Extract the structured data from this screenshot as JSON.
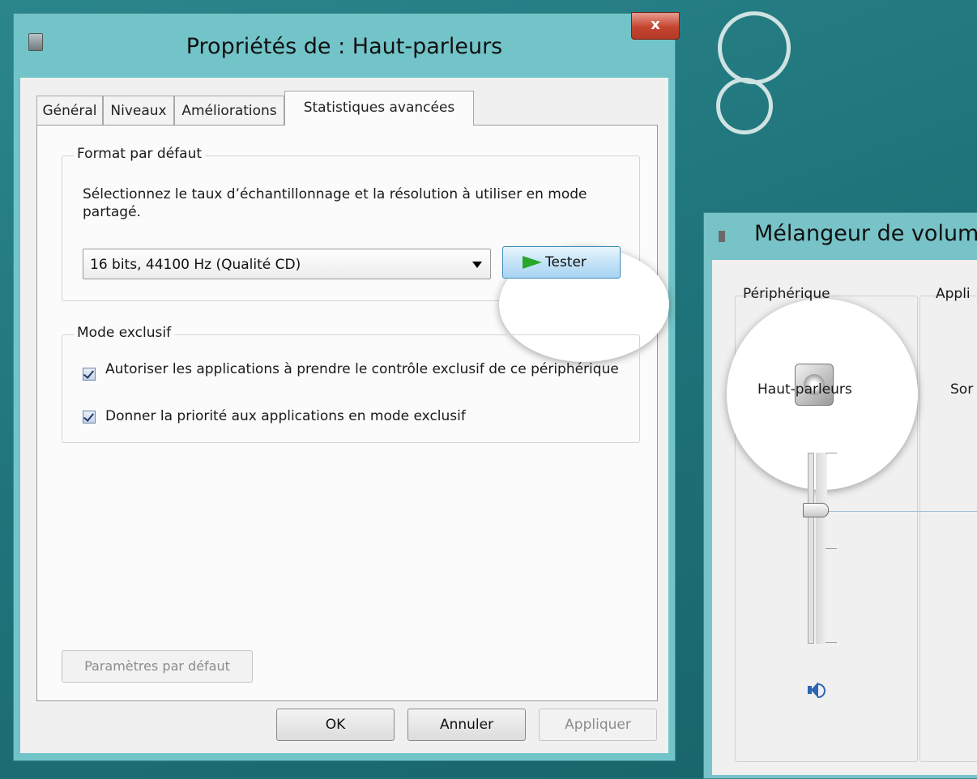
{
  "dialog": {
    "title": "Propriétés de : Haut-parleurs",
    "close_label": "x",
    "tabs": [
      {
        "label": "Général"
      },
      {
        "label": "Niveaux"
      },
      {
        "label": "Améliorations"
      },
      {
        "label": "Statistiques avancées",
        "active": true
      }
    ],
    "format_group": {
      "legend": "Format par défaut",
      "description": "Sélectionnez le taux d’échantillonnage et la résolution à utiliser en mode partagé.",
      "selected_format": "16 bits, 44100 Hz (Qualité CD)",
      "test_button": "Tester"
    },
    "exclusive_group": {
      "legend": "Mode exclusif",
      "options": [
        {
          "label": "Autoriser les applications à prendre le contrôle exclusif de ce périphérique",
          "checked": true
        },
        {
          "label": "Donner la priorité aux applications en mode exclusif",
          "checked": true
        }
      ]
    },
    "defaults_button": "Paramètres par défaut",
    "buttons": {
      "ok": "OK",
      "cancel": "Annuler",
      "apply": "Appliquer"
    }
  },
  "mixer": {
    "title": "Mélangeur de volume",
    "device_group_label": "Périphérique",
    "device_name": "Haut-parleurs",
    "apps_group_label": "Appli",
    "app_partial_label": "Sor"
  },
  "colors": {
    "desktop": "#1e6f76",
    "window_frame": "#72c4c8",
    "test_button": "#c5e3f7",
    "close_button": "#c6432f",
    "volume_icon": "#2a66b5"
  }
}
